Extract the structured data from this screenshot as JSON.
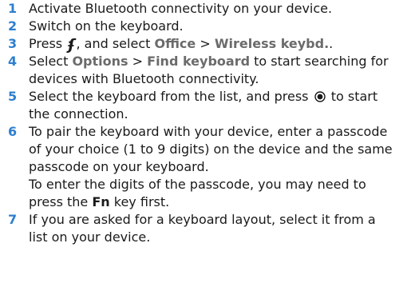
{
  "steps": [
    {
      "n": "1",
      "text": "Activate Bluetooth connectivity on your device."
    },
    {
      "n": "2",
      "text": "Switch on the keyboard."
    },
    {
      "n": "3",
      "pre": "Press",
      "icon": "menu-key-icon",
      "mid": ", and select",
      "ui1": "Office",
      "sep": ">",
      "ui2": "Wireless keybd.",
      "end": "."
    },
    {
      "n": "4",
      "pre": "Select",
      "ui1": "Options",
      "sep": ">",
      "ui2": "Find keyboard",
      "line1_end": "to start searching for",
      "line2": "devices with Bluetooth connectivity."
    },
    {
      "n": "5",
      "line1_pre": "Select the keyboard from the list, and press",
      "icon": "select-key-icon",
      "line1_end": "to start",
      "line2": "the connection."
    },
    {
      "n": "6",
      "line1": "To pair the keyboard with your device, enter a passcode",
      "line2": "of your choice (1 to 9 digits) on the device and the same",
      "line3": "passcode on your keyboard.",
      "line4": "To enter the digits of the passcode, you may need to",
      "line5_pre": "press the",
      "key": "Fn",
      "line5_end": "key first."
    },
    {
      "n": "7",
      "line1": "If you are asked for a keyboard layout, select it from a",
      "line2": "list on your device."
    }
  ],
  "colors": {
    "number": "#2e7fd0",
    "ui_text": "#6b6b6b",
    "body": "#1a1a1a"
  }
}
